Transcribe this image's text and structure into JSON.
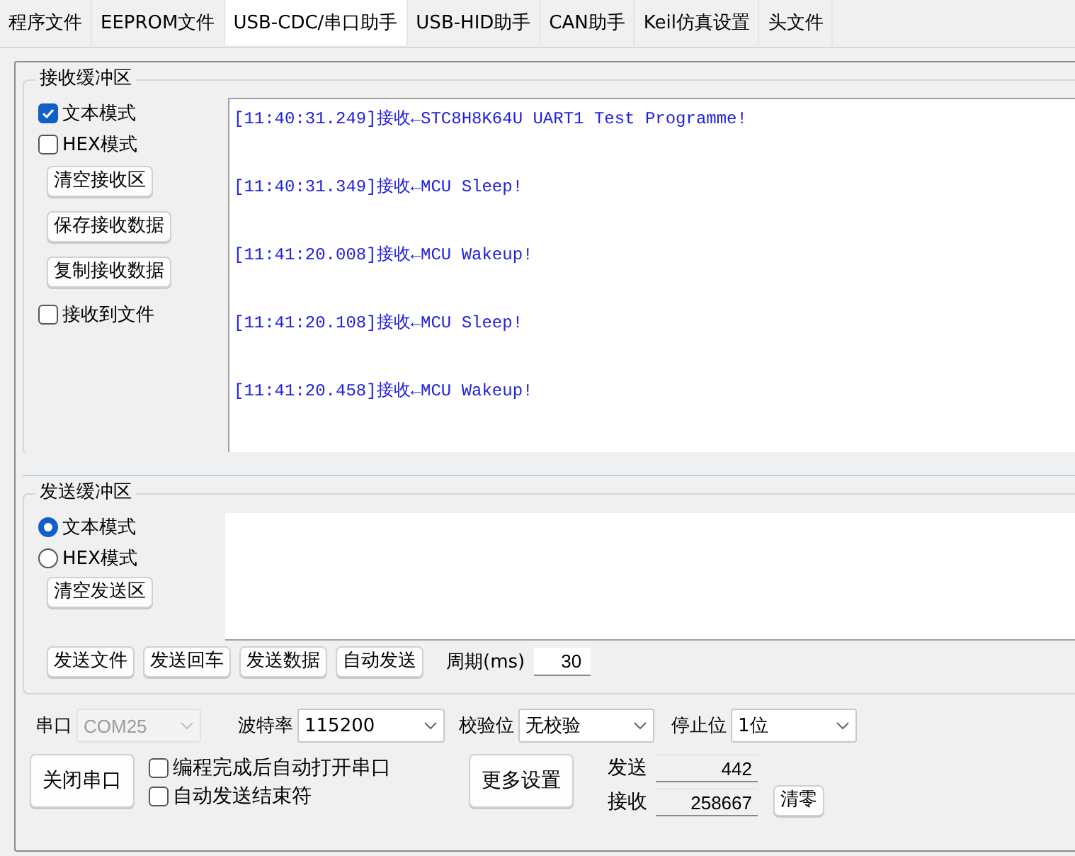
{
  "tabs": [
    {
      "label": "程序文件",
      "selected": false
    },
    {
      "label": "EEPROM文件",
      "selected": false
    },
    {
      "label": "USB-CDC/串口助手",
      "selected": true
    },
    {
      "label": "USB-HID助手",
      "selected": false
    },
    {
      "label": "CAN助手",
      "selected": false
    },
    {
      "label": "Keil仿真设置",
      "selected": false
    },
    {
      "label": "头文件",
      "selected": false
    }
  ],
  "receive": {
    "title": "接收缓冲区",
    "modes": [
      {
        "label": "文本模式",
        "checked": true
      },
      {
        "label": "HEX模式",
        "checked": false
      }
    ],
    "buttons": [
      "清空接收区",
      "保存接收数据",
      "复制接收数据"
    ],
    "to_file": {
      "label": "接收到文件",
      "checked": false
    },
    "log": [
      "[11:40:31.249]接收←STC8H8K64U UART1 Test Programme!",
      "[11:40:31.349]接收←MCU Sleep!",
      "[11:41:20.008]接收←MCU Wakeup!",
      "[11:41:20.108]接收←MCU Sleep!",
      "[11:41:20.458]接收←MCU Wakeup!"
    ]
  },
  "send": {
    "title": "发送缓冲区",
    "modes": [
      {
        "label": "文本模式",
        "selected": true
      },
      {
        "label": "HEX模式",
        "selected": false
      }
    ],
    "clear_button": "清空发送区",
    "buttons": [
      "发送文件",
      "发送回车",
      "发送数据",
      "自动发送"
    ],
    "period_label": "周期(ms)",
    "period_value": "30"
  },
  "port": {
    "fields": [
      {
        "label": "串口",
        "value": "COM25",
        "disabled": true
      },
      {
        "label": "波特率",
        "value": "115200",
        "disabled": false
      },
      {
        "label": "校验位",
        "value": "无校验",
        "disabled": false
      },
      {
        "label": "停止位",
        "value": "1位",
        "disabled": false
      }
    ],
    "open_button": "关闭串口",
    "options": [
      {
        "label": "编程完成后自动打开串口",
        "checked": false
      },
      {
        "label": "自动发送结束符",
        "checked": false
      }
    ],
    "more_button": "更多设置",
    "counters": [
      {
        "label": "发送",
        "value": "442"
      },
      {
        "label": "接收",
        "value": "258667"
      }
    ],
    "reset_button": "清零"
  }
}
